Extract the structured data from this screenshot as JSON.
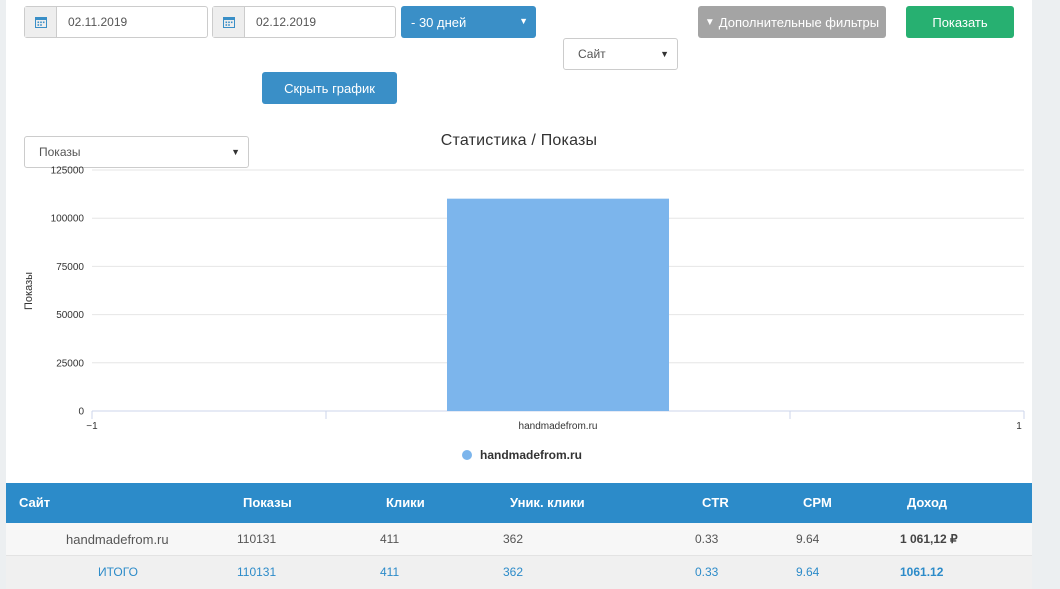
{
  "filters": {
    "date_from": "02.11.2019",
    "date_to": "02.12.2019",
    "period": "- 30 дней",
    "site_select": "Сайт",
    "extra_filters_label": "Дополнительные фильтры",
    "show_button": "Показать",
    "metric_select": "Показы",
    "hide_chart_button": "Скрыть график"
  },
  "chart_data": {
    "type": "bar",
    "title": "Статистика / Показы",
    "ylabel": "Показы",
    "xlabel": "",
    "categories": [
      "handmadefrom.ru"
    ],
    "series": [
      {
        "name": "handmadefrom.ru",
        "values": [
          110131
        ]
      }
    ],
    "ylim": [
      0,
      125000
    ],
    "yticks": [
      "125000",
      "100000",
      "75000",
      "50000",
      "25000",
      "0"
    ],
    "xticks": [
      "−1",
      "handmadefrom.ru",
      "1"
    ],
    "grid": true,
    "legend": "bottom",
    "bar_color": "#7cb5ec"
  },
  "table": {
    "headers": [
      "Сайт",
      "Показы",
      "Клики",
      "Уник. клики",
      "CTR",
      "CPM",
      "Доход"
    ],
    "rows": [
      [
        "handmadefrom.ru",
        "110131",
        "411",
        "362",
        "0.33",
        "9.64",
        "1 061,12 ₽"
      ]
    ],
    "total": [
      "ИТОГО",
      "110131",
      "411",
      "362",
      "0.33",
      "9.64",
      "1061.12"
    ]
  },
  "colors": {
    "accent_blue": "#3a8fc7",
    "header_blue": "#2c8bc9",
    "green": "#27b071",
    "gray": "#a4a4a4"
  }
}
